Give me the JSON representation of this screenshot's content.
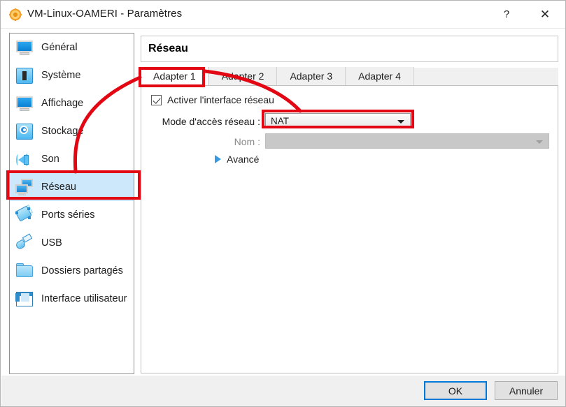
{
  "window": {
    "title": "VM-Linux-OAMERI - Paramètres",
    "app_icon": "virtualbox-gear-icon",
    "help_label": "?",
    "close_label": "✕"
  },
  "sidebar": {
    "items": [
      {
        "label": "Général",
        "icon": "monitor-icon",
        "selected": false
      },
      {
        "label": "Système",
        "icon": "cpu-chip-icon",
        "selected": false
      },
      {
        "label": "Affichage",
        "icon": "display-icon",
        "selected": false
      },
      {
        "label": "Stockage",
        "icon": "hard-disk-icon",
        "selected": false
      },
      {
        "label": "Son",
        "icon": "speaker-icon",
        "selected": false
      },
      {
        "label": "Réseau",
        "icon": "network-icon",
        "selected": true
      },
      {
        "label": "Ports séries",
        "icon": "serial-port-icon",
        "selected": false
      },
      {
        "label": "USB",
        "icon": "usb-icon",
        "selected": false
      },
      {
        "label": "Dossiers partagés",
        "icon": "folder-icon",
        "selected": false
      },
      {
        "label": "Interface utilisateur",
        "icon": "ui-window-icon",
        "selected": false
      }
    ]
  },
  "main": {
    "header_title": "Réseau",
    "tabs": [
      {
        "label": "Adapter 1",
        "active": true
      },
      {
        "label": "Adapter 2",
        "active": false
      },
      {
        "label": "Adapter 3",
        "active": false
      },
      {
        "label": "Adapter 4",
        "active": false
      }
    ],
    "enable_checkbox": {
      "label": "Activer l'interface réseau",
      "checked": true
    },
    "attached_to": {
      "label": "Mode d'accès réseau :",
      "value": "NAT"
    },
    "name_field": {
      "label": "Nom :",
      "value": "",
      "enabled": false
    },
    "advanced": {
      "label": "Avancé",
      "expanded": false,
      "icon": "triangle-right-icon"
    }
  },
  "footer": {
    "ok_label": "OK",
    "cancel_label": "Annuler"
  },
  "annotations": {
    "color": "#e30613",
    "boxes": [
      "sidebar-reseau",
      "tab-adapter-1",
      "combo-mode-acces-reseau"
    ],
    "arrows": [
      "reseau-to-adapter1",
      "adapter1-to-nat-combo"
    ]
  }
}
